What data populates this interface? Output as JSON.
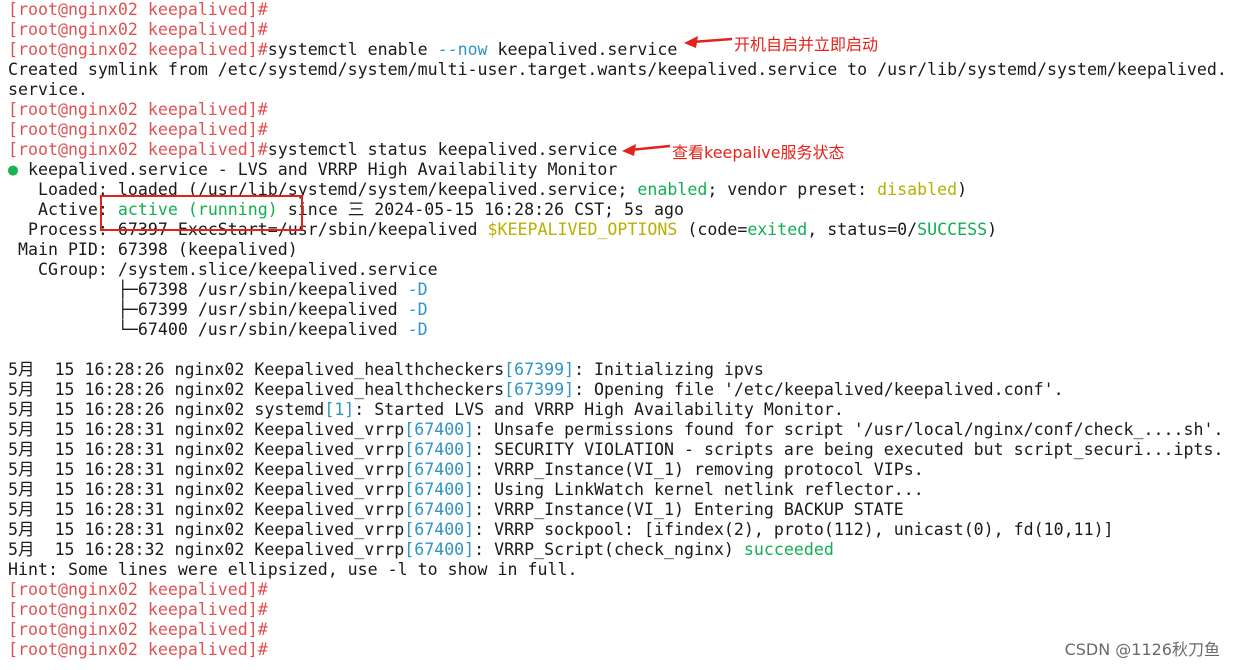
{
  "terminal": {
    "prompt": "[root@nginx02 keepalived]#",
    "cmd_enable": {
      "part1": "systemctl enable ",
      "flag": "--now",
      "part2": " keepalived.service"
    },
    "symlink_line1": "Created symlink from /etc/systemd/system/multi-user.target.wants/keepalived.service to /usr/lib/systemd/system/keepalived.",
    "symlink_line2": "service.",
    "cmd_status": "systemctl status keepalived.service",
    "status": {
      "bullet": "●",
      "title": " keepalived.service - LVS and VRRP High Availability Monitor",
      "loaded_prefix": "   Loaded: loaded (/usr/lib/systemd/system/keepalived.service; ",
      "loaded_enabled": "enabled",
      "loaded_mid": "; vendor preset: ",
      "loaded_disabled": "disabled",
      "loaded_suffix": ")",
      "active_prefix": "   Active: ",
      "active_state": "active (running)",
      "active_suffix": " since 三 2024-05-15 16:28:26 CST; 5s ago",
      "process_prefix": "  Process: 67397 ExecStart=/usr/sbin/keepalived ",
      "process_var": "$KEEPALIVED_OPTIONS",
      "process_mid1": " (code=",
      "process_code": "exited",
      "process_mid2": ", status=0/",
      "process_success": "SUCCESS",
      "process_suffix": ")",
      "mainpid": " Main PID: 67398 (keepalived)",
      "cgroup": "   CGroup: /system.slice/keepalived.service",
      "cgroup_children": [
        {
          "tree": "           ├─",
          "pid": "67398",
          "path": " /usr/sbin/keepalived ",
          "flag": "-D"
        },
        {
          "tree": "           ├─",
          "pid": "67399",
          "path": " /usr/sbin/keepalived ",
          "flag": "-D"
        },
        {
          "tree": "           └─",
          "pid": "67400",
          "path": " /usr/sbin/keepalived ",
          "flag": "-D"
        }
      ]
    },
    "logs": [
      {
        "pre": "5月  15 16:28:26 nginx02 Keepalived_healthcheckers",
        "pid": "[67399]",
        "msg": ": Initializing ipvs",
        "ok": ""
      },
      {
        "pre": "5月  15 16:28:26 nginx02 Keepalived_healthcheckers",
        "pid": "[67399]",
        "msg": ": Opening file '/etc/keepalived/keepalived.conf'.",
        "ok": ""
      },
      {
        "pre": "5月  15 16:28:26 nginx02 systemd",
        "pid": "[1]",
        "msg": ": Started LVS and VRRP High Availability Monitor.",
        "ok": ""
      },
      {
        "pre": "5月  15 16:28:31 nginx02 Keepalived_vrrp",
        "pid": "[67400]",
        "msg": ": Unsafe permissions found for script '/usr/local/nginx/conf/check_....sh'.",
        "ok": ""
      },
      {
        "pre": "5月  15 16:28:31 nginx02 Keepalived_vrrp",
        "pid": "[67400]",
        "msg": ": SECURITY VIOLATION - scripts are being executed but script_securi...ipts.",
        "ok": ""
      },
      {
        "pre": "5月  15 16:28:31 nginx02 Keepalived_vrrp",
        "pid": "[67400]",
        "msg": ": VRRP_Instance(VI_1) removing protocol VIPs.",
        "ok": ""
      },
      {
        "pre": "5月  15 16:28:31 nginx02 Keepalived_vrrp",
        "pid": "[67400]",
        "msg": ": Using LinkWatch kernel netlink reflector...",
        "ok": ""
      },
      {
        "pre": "5月  15 16:28:31 nginx02 Keepalived_vrrp",
        "pid": "[67400]",
        "msg": ": VRRP_Instance(VI_1) Entering BACKUP STATE",
        "ok": ""
      },
      {
        "pre": "5月  15 16:28:31 nginx02 Keepalived_vrrp",
        "pid": "[67400]",
        "msg": ": VRRP sockpool: [ifindex(2), proto(112), unicast(0), fd(10,11)]",
        "ok": ""
      },
      {
        "pre": "5月  15 16:28:32 nginx02 Keepalived_vrrp",
        "pid": "[67400]",
        "msg": ": VRRP_Script(check_nginx) ",
        "ok": "succeeded"
      }
    ],
    "hint": "Hint: Some lines were ellipsized, use -l to show in full."
  },
  "annotations": {
    "enable_note": "开机自启并立即启动",
    "status_note": "查看keepalive服务状态"
  },
  "watermark": "CSDN @1126秋刀鱼",
  "colors": {
    "prompt": "#e05252",
    "green": "#12b050",
    "yellow": "#b8b000",
    "blue": "#2e95c8",
    "annotation_red": "#e2231a"
  }
}
